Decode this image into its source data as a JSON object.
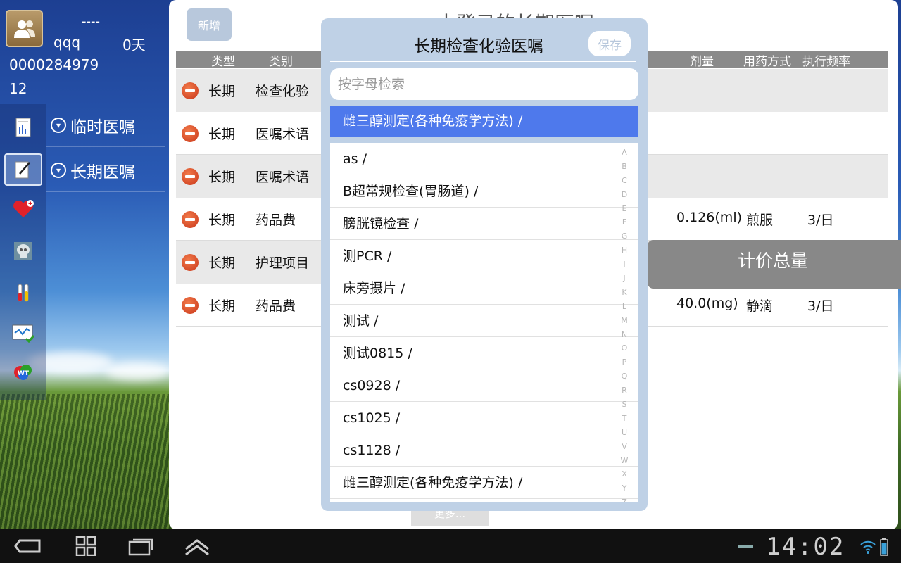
{
  "user": {
    "name_line": "----",
    "username": "qqq",
    "days": "0天",
    "id": "0000284979",
    "bed": "12"
  },
  "menu": {
    "temporary": "临时医嘱",
    "longterm": "长期医嘱"
  },
  "main": {
    "add_button": "新增",
    "title": "本登录的长期医嘱",
    "headers": {
      "type": "类型",
      "category": "类别",
      "dose": "剂量",
      "usage": "用药方式",
      "frequency": "执行频率"
    },
    "rows": [
      {
        "type": "长期",
        "category": "检查化验",
        "dose": "",
        "usage": "",
        "frequency": ""
      },
      {
        "type": "长期",
        "category": "医嘱术语",
        "dose": "",
        "usage": "",
        "frequency": ""
      },
      {
        "type": "长期",
        "category": "医嘱术语",
        "dose": "",
        "usage": "",
        "frequency": ""
      },
      {
        "type": "长期",
        "category": "药品费",
        "dose": "0.126(ml)",
        "usage": "煎服",
        "frequency": "3/日"
      },
      {
        "type": "长期",
        "category": "护理项目",
        "dose": "",
        "usage": "",
        "frequency": ""
      },
      {
        "type": "长期",
        "category": "药品费",
        "dose": "40.0(mg)",
        "usage": "静滴",
        "frequency": "3/日"
      }
    ],
    "price_total": "计价总量",
    "more_button": "更多..."
  },
  "dialog": {
    "title": "长期检查化验医嘱",
    "save": "保存",
    "search_placeholder": "按字母检索",
    "selected": "雌三醇测定(各种免疫学方法) /",
    "items": [
      "as /",
      "B超常规检查(胃肠道) /",
      "膀胱镜检查 /",
      "测PCR /",
      "床旁摄片 /",
      "测试 /",
      "测试0815 /",
      "cs0928 /",
      "cs1025 /",
      "cs1128 /",
      "雌三醇测定(各种免疫学方法) /"
    ],
    "alphabet": [
      "A",
      "B",
      "C",
      "D",
      "E",
      "F",
      "G",
      "H",
      "I",
      "J",
      "K",
      "L",
      "M",
      "N",
      "O",
      "P",
      "Q",
      "R",
      "S",
      "T",
      "U",
      "V",
      "W",
      "X",
      "Y",
      "Z"
    ]
  },
  "system": {
    "clock": "14:02"
  }
}
